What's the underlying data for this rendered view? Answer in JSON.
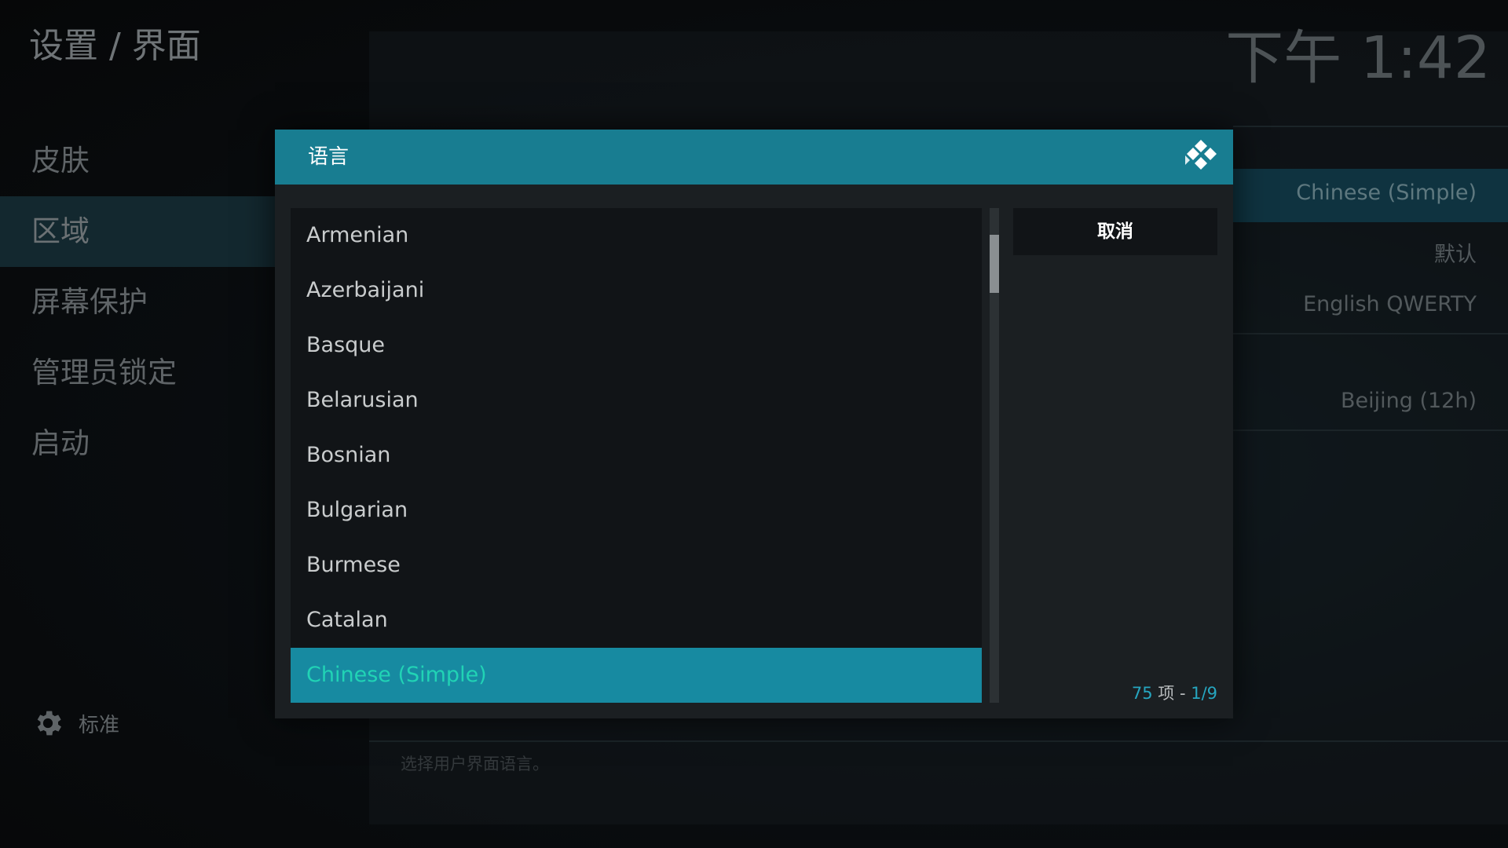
{
  "header": {
    "breadcrumb": "设置 / 界面",
    "clock": "下午 1:42"
  },
  "sidebar": {
    "items": [
      {
        "label": "皮肤",
        "active": false
      },
      {
        "label": "区域",
        "active": true
      },
      {
        "label": "屏幕保护",
        "active": false
      },
      {
        "label": "管理员锁定",
        "active": false
      },
      {
        "label": "启动",
        "active": false
      }
    ],
    "settings_level": "标准"
  },
  "background_settings": {
    "values": [
      "Chinese (Simple)",
      "默认",
      "English QWERTY",
      "Beijing (12h)"
    ],
    "description": "选择用户界面语言。"
  },
  "dialog": {
    "title": "语言",
    "items": [
      {
        "label": "Armenian",
        "selected": false
      },
      {
        "label": "Azerbaijani",
        "selected": false
      },
      {
        "label": "Basque",
        "selected": false
      },
      {
        "label": "Belarusian",
        "selected": false
      },
      {
        "label": "Bosnian",
        "selected": false
      },
      {
        "label": "Bulgarian",
        "selected": false
      },
      {
        "label": "Burmese",
        "selected": false
      },
      {
        "label": "Catalan",
        "selected": false
      },
      {
        "label": "Chinese (Simple)",
        "selected": true
      }
    ],
    "cancel_label": "取消",
    "count": {
      "total": "75",
      "unit": " 项 - ",
      "page": "1/9"
    },
    "scroll_position": 0.11
  },
  "colors": {
    "header_bg": "#187d91",
    "selected_bg": "#178aa1",
    "selected_text": "#21d3b5",
    "accent_number": "#26a6c0"
  },
  "icons": {
    "logo": "kodi-logo-icon",
    "settings_level": "gear-icon"
  }
}
